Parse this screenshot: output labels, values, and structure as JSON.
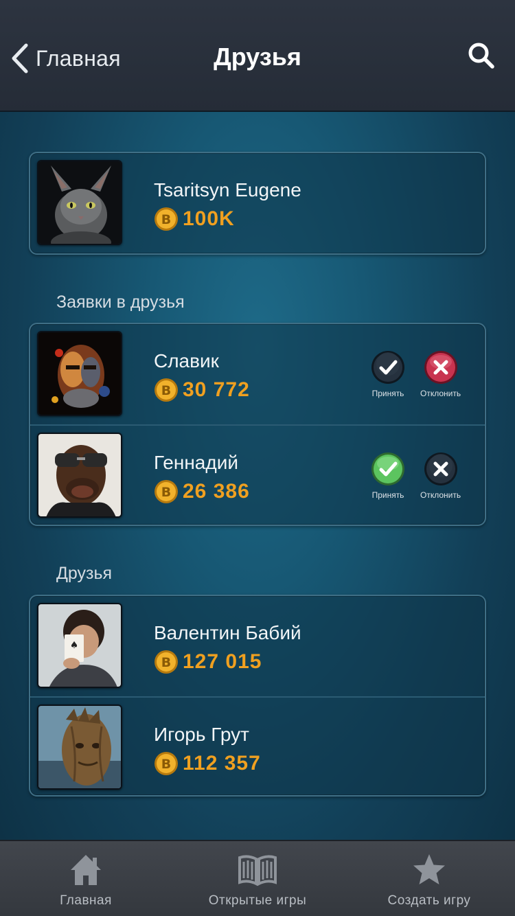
{
  "header": {
    "back_label": "Главная",
    "title": "Друзья"
  },
  "profile": {
    "name": "Tsaritsyn Eugene",
    "coins": "100K",
    "avatar": "sphynx-cat-photo"
  },
  "requests": {
    "section_label": "Заявки в друзья",
    "accept_label": "Принять",
    "decline_label": "Отклонить",
    "items": [
      {
        "name": "Славик",
        "coins": "30 772",
        "avatar": "man-portrait-painting"
      },
      {
        "name": "Геннадий",
        "coins": "26 386",
        "avatar": "caricature-sunglasses"
      }
    ]
  },
  "friends": {
    "section_label": "Друзья",
    "items": [
      {
        "name": "Валентин Бабий",
        "coins": "127 015",
        "avatar": "man-holding-card"
      },
      {
        "name": "Игорь Грут",
        "coins": "112 357",
        "avatar": "groot-photo"
      }
    ]
  },
  "tabbar": {
    "home": "Главная",
    "open_games": "Открытые игры",
    "create_game": "Создать игру"
  },
  "colors": {
    "coin_text": "#f0a020",
    "accept_active": "#5cc45f",
    "decline_active": "#c8334f",
    "button_dark": "#1f2b38"
  }
}
